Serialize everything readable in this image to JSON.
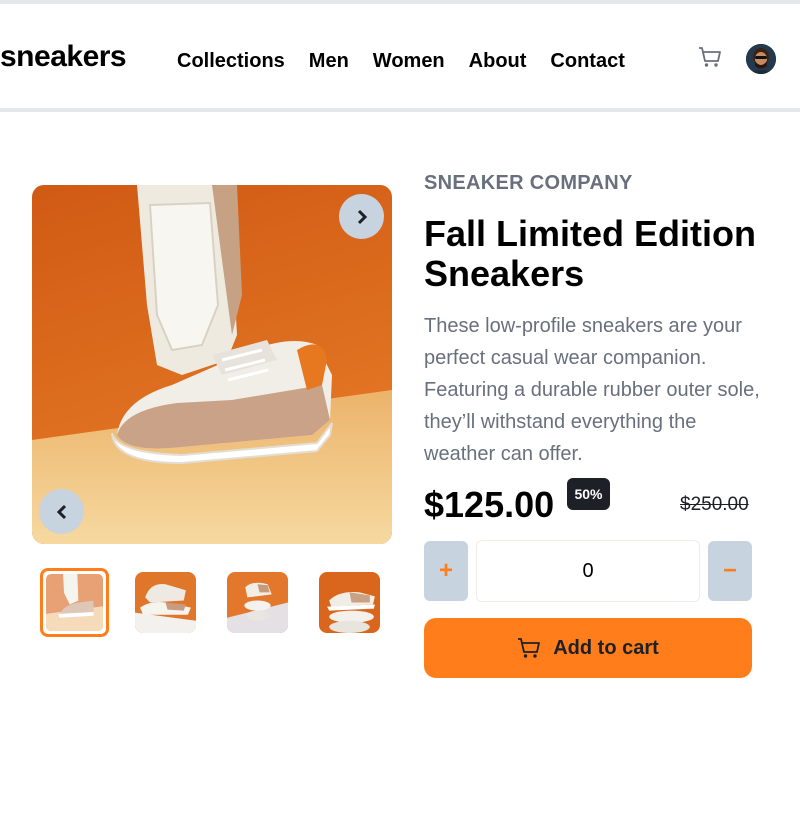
{
  "header": {
    "logo": "sneakers",
    "nav": [
      "Collections",
      "Men",
      "Women",
      "About",
      "Contact"
    ],
    "cart_icon": "cart-icon",
    "avatar_icon": "avatar"
  },
  "product": {
    "company": "SNEAKER COMPANY",
    "title": "Fall Limited Edition Sneakers",
    "description": "These low-profile sneakers are your perfect casual wear companion. Featuring a durable rubber outer sole, they’ll withstand everything the weather can offer.",
    "price": "$125.00",
    "discount": "50%",
    "original_price": "$250.00"
  },
  "gallery": {
    "next_icon": "chevron-right-icon",
    "prev_icon": "chevron-left-icon",
    "thumbnail_count": 4,
    "active_thumbnail": 1
  },
  "quantity": {
    "plus_label": "+",
    "value": "0",
    "minus_label": "−"
  },
  "cart_button": {
    "label": "Add to cart",
    "icon": "cart-icon"
  },
  "colors": {
    "accent": "#ff7d1a",
    "pale_blue": "#c8d3e0",
    "text_gray": "#68707d",
    "dark": "#1d2026"
  }
}
